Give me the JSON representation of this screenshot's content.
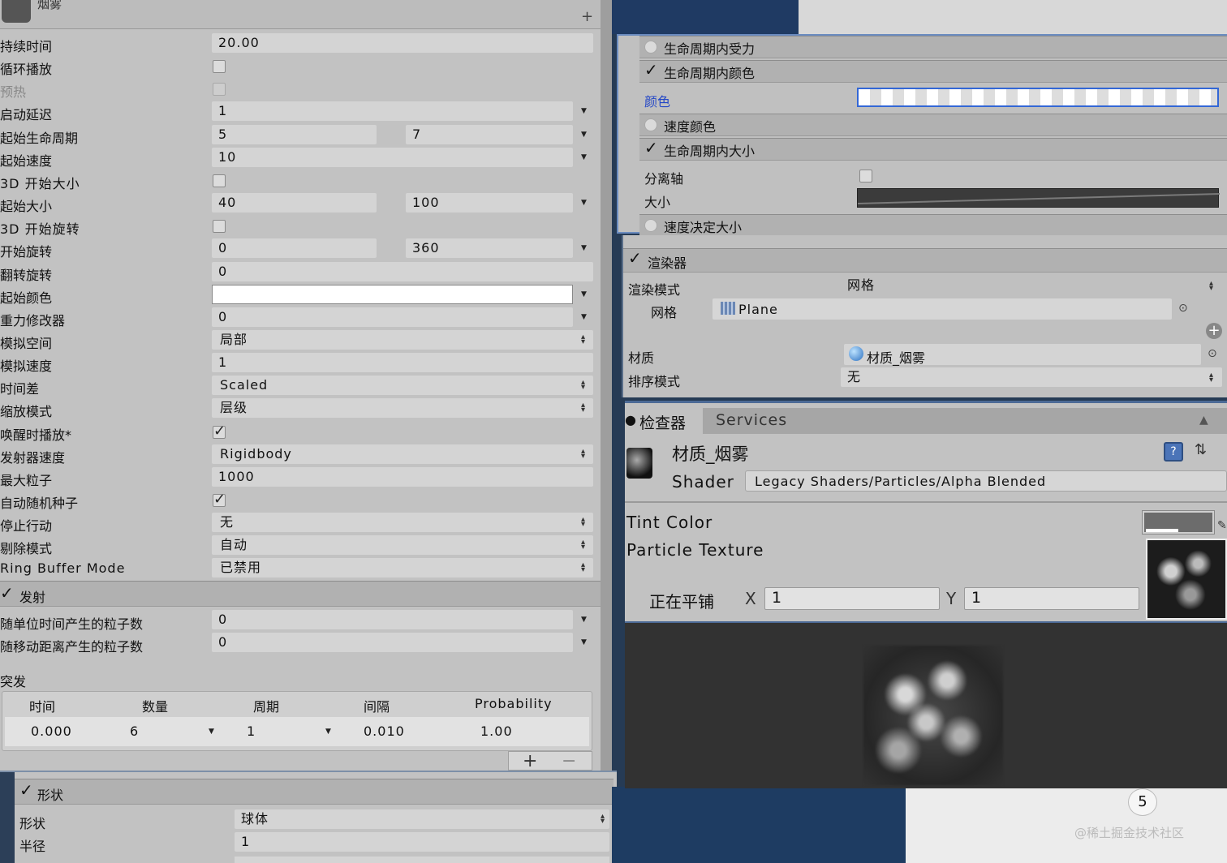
{
  "main": {
    "title": "烟雾",
    "plus": "+",
    "rows": [
      {
        "label": "持续时间",
        "value": "20.00",
        "type": "field"
      },
      {
        "label": "循环播放",
        "type": "check",
        "checked": false
      },
      {
        "label": "预热",
        "type": "check",
        "checked": false,
        "disabled": true
      },
      {
        "label": "启动延迟",
        "value": "1",
        "type": "field-arrow"
      },
      {
        "label": "起始生命周期",
        "value": "5",
        "value2": "7",
        "type": "range"
      },
      {
        "label": "起始速度",
        "value": "10",
        "type": "field-arrow"
      },
      {
        "label": "3D 开始大小",
        "type": "check",
        "checked": false
      },
      {
        "label": "起始大小",
        "value": "40",
        "value2": "100",
        "type": "range"
      },
      {
        "label": "3D 开始旋转",
        "type": "check",
        "checked": false
      },
      {
        "label": "开始旋转",
        "value": "0",
        "value2": "360",
        "type": "range"
      },
      {
        "label": "翻转旋转",
        "value": "0",
        "type": "field"
      },
      {
        "label": "起始颜色",
        "type": "color"
      },
      {
        "label": "重力修改器",
        "value": "0",
        "type": "field-arrow"
      },
      {
        "label": "模拟空间",
        "value": "局部",
        "type": "dropdown"
      },
      {
        "label": "模拟速度",
        "value": "1",
        "type": "field"
      },
      {
        "label": "时间差",
        "value": "Scaled",
        "type": "dropdown"
      },
      {
        "label": "缩放模式",
        "value": "层级",
        "type": "dropdown"
      },
      {
        "label": "唤醒时播放*",
        "type": "check",
        "checked": true
      },
      {
        "label": "发射器速度",
        "value": "Rigidbody",
        "type": "dropdown"
      },
      {
        "label": "最大粒子",
        "value": "1000",
        "type": "field"
      },
      {
        "label": "自动随机种子",
        "type": "check",
        "checked": true
      },
      {
        "label": "停止行动",
        "value": "无",
        "type": "dropdown"
      },
      {
        "label": "剔除模式",
        "value": "自动",
        "type": "dropdown"
      },
      {
        "label": "Ring Buffer Mode",
        "value": "已禁用",
        "type": "dropdown"
      }
    ],
    "emission": {
      "header": "发射",
      "rows": [
        {
          "label": "随单位时间产生的粒子数",
          "value": "0"
        },
        {
          "label": "随移动距离产生的粒子数",
          "value": "0"
        }
      ],
      "burst_label": "突发",
      "burst_headers": [
        "时间",
        "数量",
        "周期",
        "间隔",
        "Probability"
      ],
      "burst_row": [
        "0.000",
        "6",
        "1",
        "0.010",
        "1.00"
      ],
      "add": "+",
      "remove": "−"
    },
    "shape": {
      "header": "形状",
      "rows": [
        {
          "label": "形状",
          "value": "球体",
          "type": "dropdown"
        },
        {
          "label": "半径",
          "value": "1",
          "type": "field"
        }
      ]
    }
  },
  "right_top": {
    "rows": [
      {
        "label": "生命周期内受力",
        "checked": false
      },
      {
        "label": "生命周期内颜色",
        "checked": true
      },
      {
        "label": "速度颜色",
        "checked": false
      },
      {
        "label": "生命周期内大小",
        "checked": true
      },
      {
        "label": "速度决定大小",
        "checked": false
      }
    ],
    "color_label": "颜色",
    "separate_axes_label": "分离轴",
    "size_label": "大小"
  },
  "renderer": {
    "header": "渲染器",
    "render_mode_label": "渲染模式",
    "render_mode_value": "网格",
    "mesh_label": "网格",
    "mesh_value": "Plane",
    "material_label": "材质",
    "material_value": "材质_烟雾",
    "sort_mode_label": "排序模式",
    "sort_mode_value": "无"
  },
  "inspector": {
    "tabs": [
      "检查器",
      "Services"
    ],
    "material_name": "材质_烟雾",
    "shader_label": "Shader",
    "shader_value": "Legacy Shaders/Particles/Alpha Blended",
    "tint_label": "Tint Color",
    "texture_label": "Particle Texture",
    "tiling_label": "正在平铺",
    "x_label": "X",
    "x_value": "1",
    "y_label": "Y",
    "y_value": "1"
  },
  "scene": {
    "badge": "5"
  },
  "watermark": "@稀土掘金技术社区"
}
